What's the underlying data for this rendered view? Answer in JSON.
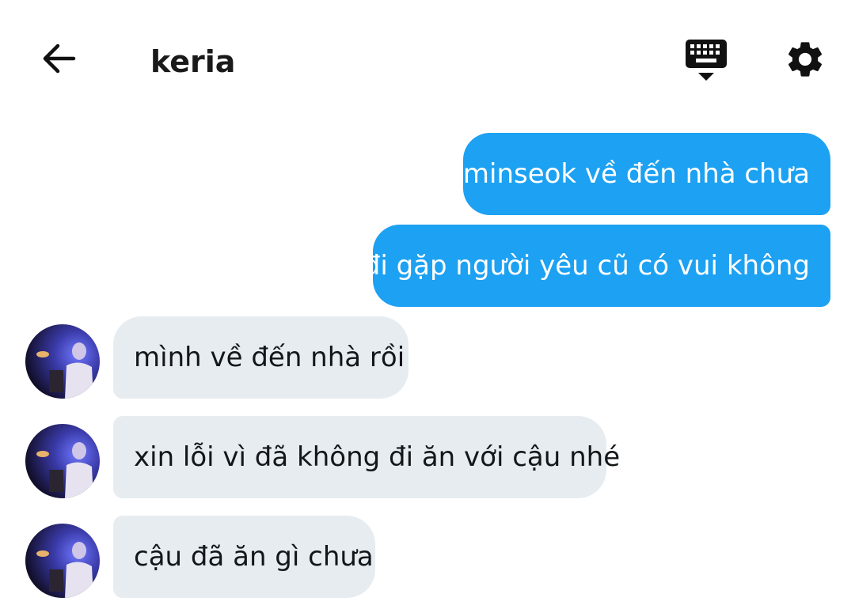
{
  "header": {
    "title": "keria",
    "back_icon": "arrow-left-icon",
    "keyboard_icon": "keyboard-hide-icon",
    "settings_icon": "gear-icon"
  },
  "messages": {
    "sent": [
      {
        "text": "minseok về đến nhà chưa"
      },
      {
        "text": "đi gặp người yêu cũ có vui không"
      }
    ],
    "received": [
      {
        "text": "mình về đến nhà rồi"
      },
      {
        "text": "xin lỗi vì đã không đi ăn với cậu nhé"
      },
      {
        "text": "cậu đã ăn gì chưa"
      }
    ]
  },
  "colors": {
    "sent_bubble": "#1da1f2",
    "received_bubble": "#e6ecf0",
    "text_dark": "#14171a"
  }
}
